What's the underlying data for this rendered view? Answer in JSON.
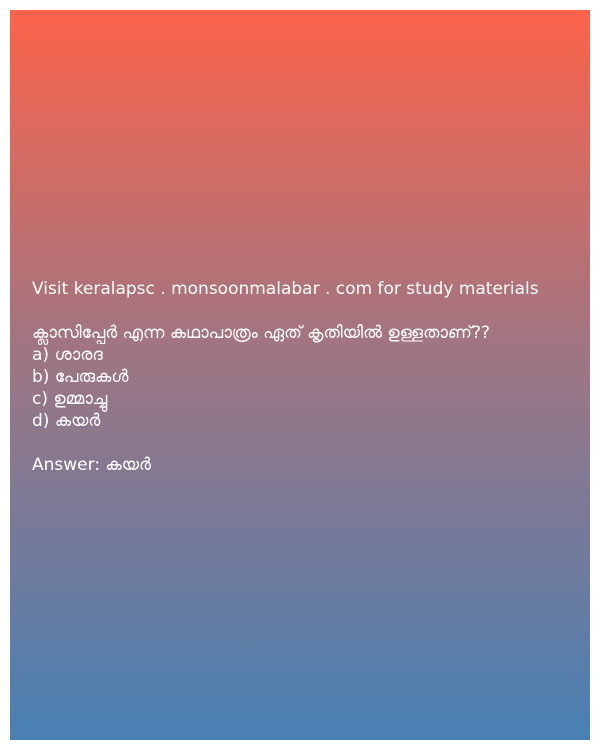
{
  "promo_text": "Visit keralapsc . monsoonmalabar . com for study materials",
  "question": " ക്ലാസിപ്പേർ എന്ന കഥാപാത്രം ഏത് കൃതിയിൽ ഉള്ളതാണ്??",
  "options": [
    "a) ശാരദ",
    "b) പേരുകൾ",
    "c) ഉമ്മാച്ചു",
    "d) കയർ"
  ],
  "answer": "Answer: കയർ",
  "colors": {
    "gradient_top": "#fd634a",
    "gradient_bottom": "#4880b4",
    "text": "#ffffff"
  }
}
